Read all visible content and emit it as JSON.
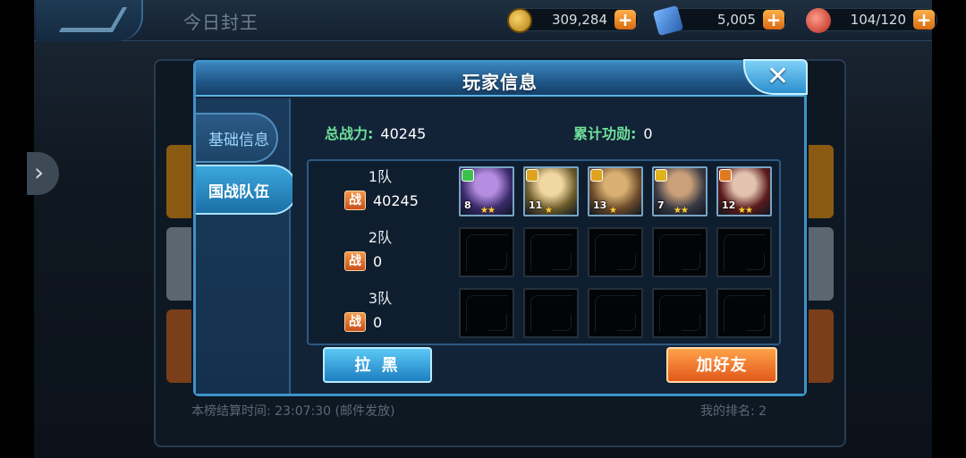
{
  "background": {
    "title": "今日封王",
    "resources": [
      {
        "icon": "coin-icon",
        "value": "309,284"
      },
      {
        "icon": "ticket-icon",
        "value": "5,005"
      },
      {
        "icon": "gem-icon",
        "value": "104/120"
      }
    ],
    "footer_left": "本榜结算时间: 23:07:30 (邮件发放)",
    "footer_right": "我的排名: 2"
  },
  "dialog": {
    "title": "玩家信息",
    "tabs": [
      {
        "label": "基础信息",
        "active": false
      },
      {
        "label": "国战队伍",
        "active": true
      }
    ],
    "total_power_label": "总战力:",
    "total_power_value": "40245",
    "merit_label": "累计功勋:",
    "merit_value": "0",
    "power_badge": "战",
    "teams": [
      {
        "name": "1队",
        "power": "40245",
        "heroes": [
          {
            "level": "8",
            "stars": "★★",
            "emblem_color": "#39c24a",
            "palette": [
              "#3a2a6b",
              "#b58de0"
            ]
          },
          {
            "level": "11",
            "stars": "★",
            "emblem_color": "#e0a21f",
            "palette": [
              "#6b5a2a",
              "#f0d6a0"
            ]
          },
          {
            "level": "13",
            "stars": "★",
            "emblem_color": "#e0a21f",
            "palette": [
              "#6b4a2a",
              "#d9b072"
            ]
          },
          {
            "level": "7",
            "stars": "★★",
            "emblem_color": "#e0b21f",
            "palette": [
              "#3a3a44",
              "#c9a07a"
            ]
          },
          {
            "level": "12",
            "stars": "★★",
            "emblem_color": "#e07a1f",
            "palette": [
              "#5a1a1a",
              "#e3c3b0"
            ]
          }
        ]
      },
      {
        "name": "2队",
        "power": "0",
        "heroes": []
      },
      {
        "name": "3队",
        "power": "0",
        "heroes": []
      }
    ],
    "block_button": "拉 黑",
    "add_friend_button": "加好友"
  }
}
